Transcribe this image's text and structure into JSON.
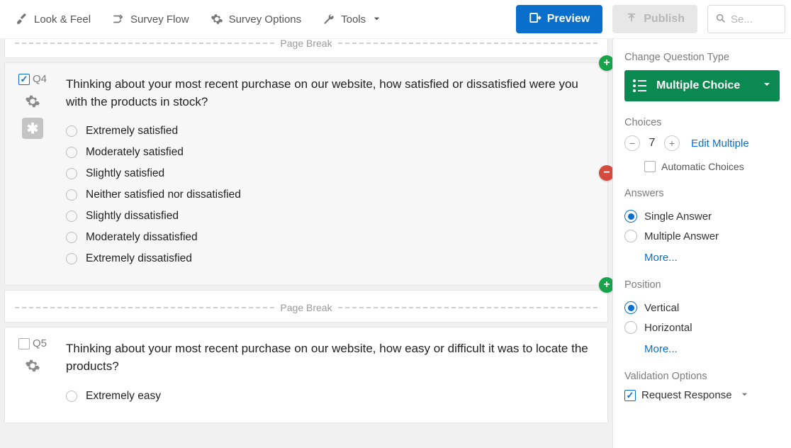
{
  "toolbar": {
    "look_feel": "Look & Feel",
    "survey_flow": "Survey Flow",
    "survey_options": "Survey Options",
    "tools": "Tools",
    "preview": "Preview",
    "publish": "Publish",
    "search_placeholder": "Se..."
  },
  "page_break_label": "Page Break",
  "q4": {
    "id": "Q4",
    "checked": true,
    "text": "Thinking about your most recent purchase on our website, how satisfied or dissatisfied were you with the products in stock?",
    "choices": [
      "Extremely satisfied",
      "Moderately satisfied",
      "Slightly satisfied",
      "Neither satisfied nor dissatisfied",
      "Slightly dissatisfied",
      "Moderately dissatisfied",
      "Extremely dissatisfied"
    ]
  },
  "q5": {
    "id": "Q5",
    "checked": false,
    "text": "Thinking about your most recent purchase on our website, how easy or difficult it was to locate the products?",
    "first_choice": "Extremely easy"
  },
  "panel": {
    "change_type": "Change Question Type",
    "qtype": "Multiple Choice",
    "choices_label": "Choices",
    "choices_count": "7",
    "edit_multiple": "Edit Multiple",
    "automatic_choices": "Automatic Choices",
    "answers_label": "Answers",
    "single_answer": "Single Answer",
    "multiple_answer": "Multiple Answer",
    "more": "More...",
    "position_label": "Position",
    "vertical": "Vertical",
    "horizontal": "Horizontal",
    "validation_label": "Validation Options",
    "request_response": "Request Response"
  }
}
